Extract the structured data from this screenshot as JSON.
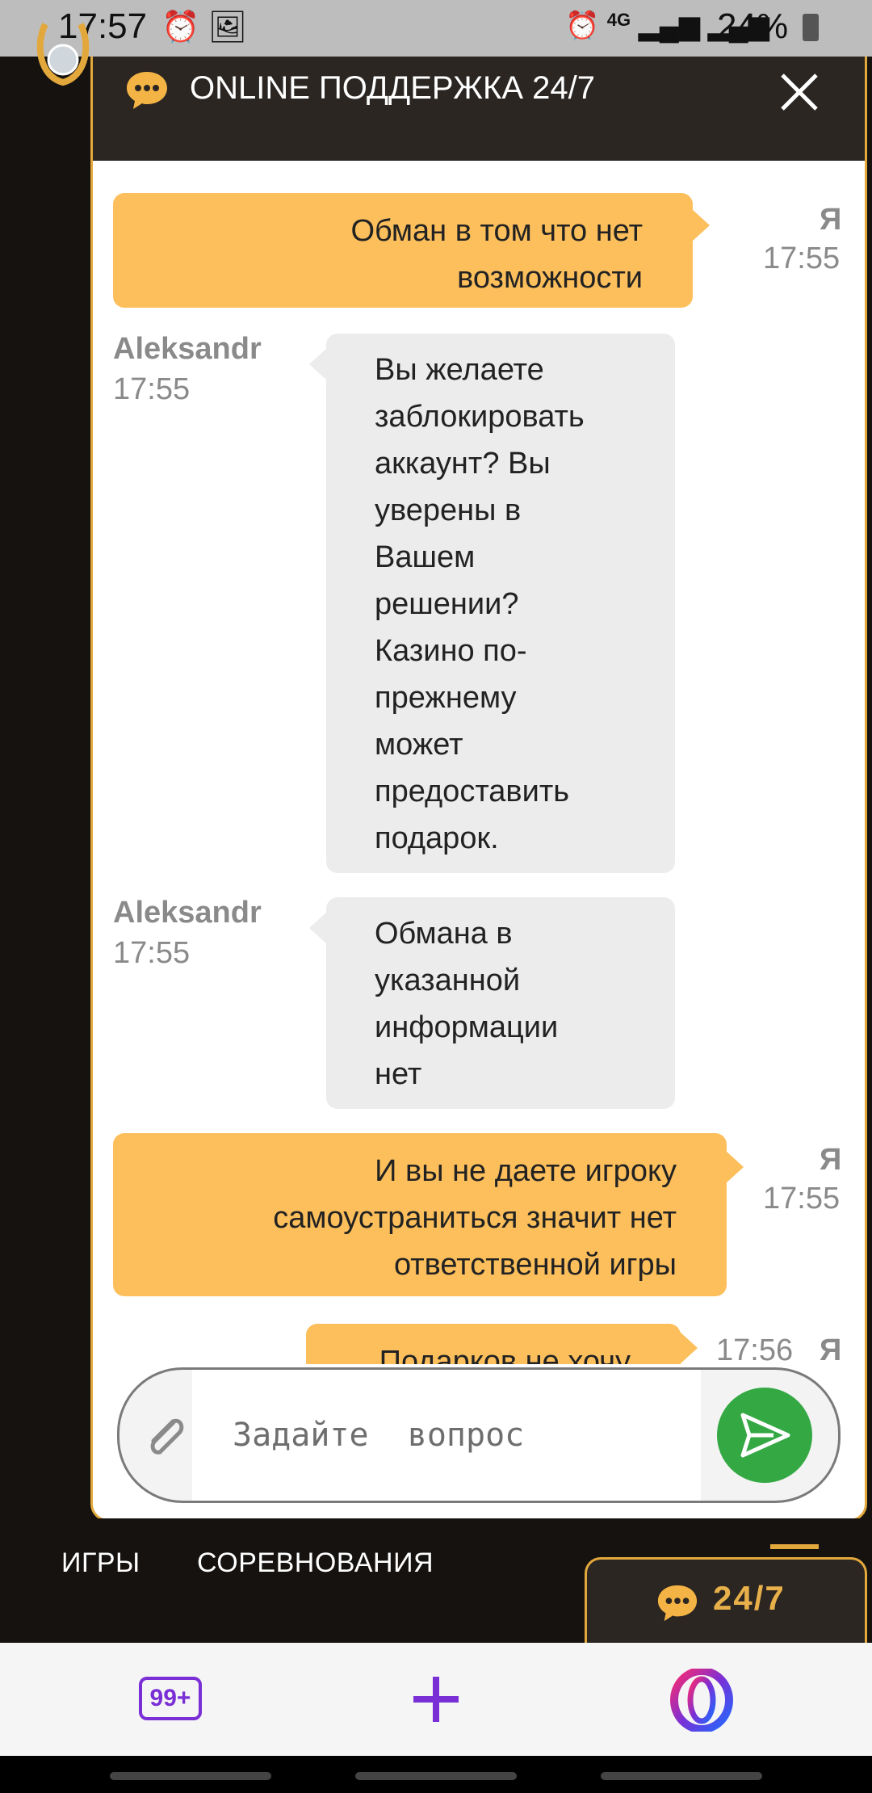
{
  "status_bar": {
    "time": "17:57",
    "left_icons": [
      "alarm-icon",
      "image-icon"
    ],
    "right_icons": [
      "alarm-icon",
      "4g-icon",
      "signal-icon",
      "signal-icon"
    ],
    "network": "4G",
    "battery": "24%"
  },
  "chat": {
    "title": "ONLINE ПОДДЕРЖКА 24/7",
    "messages": [
      {
        "sender": "Я",
        "time": "17:55",
        "text": "Обман в том что нет возможности",
        "lines": [
          "Обман в том что нет",
          "возможности"
        ]
      },
      {
        "sender": "Aleksandr",
        "time": "17:55",
        "text": "Вы желаете заблокировать аккаунт? Вы уверены в Вашем решении? Казино по-прежнему может предоставить подарок.",
        "lines": [
          "Вы желаете",
          "заблокировать",
          "аккаунт? Вы",
          "уверены в",
          "Вашем",
          "решении?",
          "Казино по-",
          "прежнему",
          "может",
          "предоставить",
          "подарок."
        ]
      },
      {
        "sender": "Aleksandr",
        "time": "17:55",
        "text": "Обмана в указанной информации нет",
        "lines": [
          "Обмана в",
          "указанной",
          "информации",
          "нет"
        ]
      },
      {
        "sender": "Я",
        "time": "17:55",
        "text": "И вы не даете игроку самоустраниться значит нет ответственной игры",
        "lines": [
          "И вы не даете игроку",
          "самоустраниться  значит нет",
          "ответственной игры"
        ]
      },
      {
        "sender": "Я",
        "time": "17:56",
        "text": "Подарков не хочу",
        "lines": [
          "Подарков не хочу"
        ]
      }
    ],
    "input_placeholder": "Задайте  вопрос"
  },
  "bottom_nav": {
    "tabs": [
      "ИГРЫ",
      "СОРЕВНОВАНИЯ"
    ],
    "support_tab_label": "24/7"
  },
  "browser": {
    "tabs_count": "99+"
  },
  "colors": {
    "accent": "#e3a83c",
    "user_bubble": "#fcbf5c",
    "agent_bubble": "#ececec",
    "send_button": "#33a843",
    "header_bg": "#2b2622",
    "browser_accent": "#7a2fd6"
  }
}
